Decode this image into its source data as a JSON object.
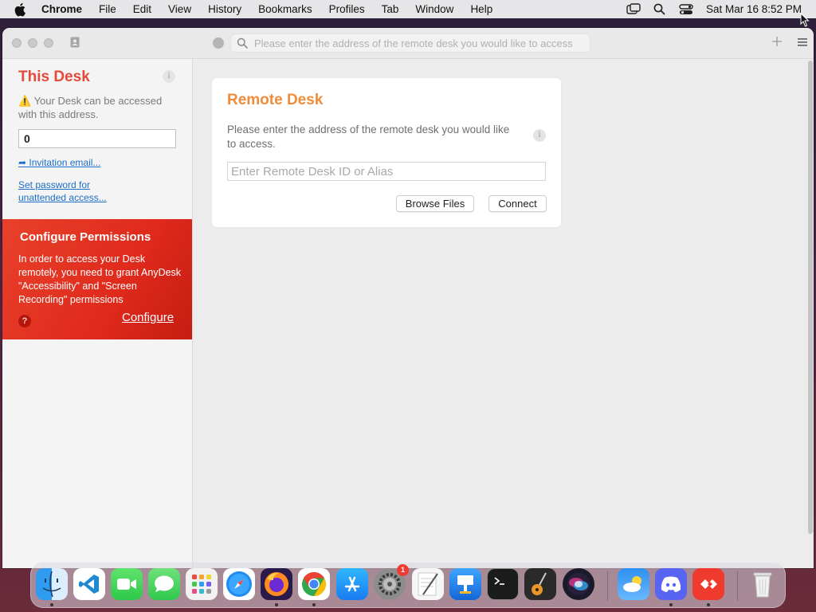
{
  "menubar": {
    "app_name": "Chrome",
    "items": [
      "File",
      "Edit",
      "View",
      "History",
      "Bookmarks",
      "Profiles",
      "Tab",
      "Window",
      "Help"
    ],
    "clock": "Sat Mar 16  8:52 PM"
  },
  "window": {
    "address_placeholder": "Please enter the address of the remote desk you would like to access"
  },
  "sidebar": {
    "title": "This Desk",
    "note_icon": "⚠️",
    "note": "Your Desk can be accessed with this address.",
    "desk_id": "0",
    "invitation_link": "➦ Invitation email...",
    "password_link": "Set password for unattended access...",
    "permissions": {
      "title": "Configure Permissions",
      "text": "In order to access your Desk remotely, you need to grant AnyDesk \"Accessibility\" and \"Screen Recording\" permissions",
      "help": "?",
      "configure": "Configure"
    }
  },
  "main": {
    "card_title": "Remote Desk",
    "description": "Please enter the address of the remote desk you would like to access.",
    "input_placeholder": "Enter Remote Desk ID or Alias",
    "browse_button": "Browse Files",
    "connect_button": "Connect"
  },
  "info_glyph": "i",
  "dock": {
    "apps": [
      "Finder",
      "Visual Studio Code",
      "FaceTime",
      "Messages",
      "Launchpad",
      "Safari",
      "Firefox",
      "Chrome",
      "App Store",
      "System Preferences",
      "TextEdit",
      "Keynote",
      "Terminal",
      "GarageBand",
      "Siri",
      "Weather",
      "Discord",
      "AnyDesk",
      "Trash"
    ],
    "settings_badge": "1"
  },
  "colors": {
    "this_desk_title": "#e24a3b",
    "remote_desk_title": "#f08c3a",
    "permissions_bg": "#e02a1c",
    "link": "#1d6fc9"
  }
}
